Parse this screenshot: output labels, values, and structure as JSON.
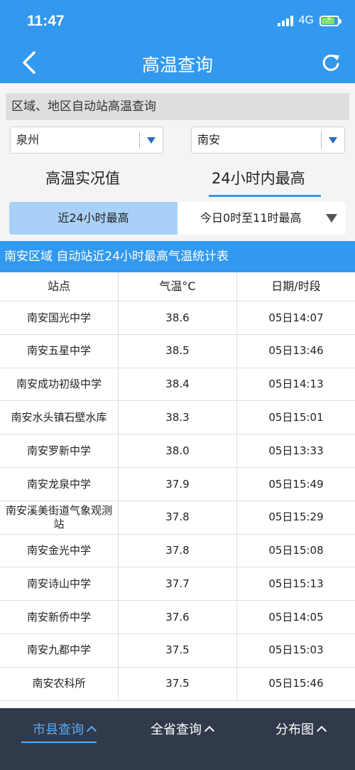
{
  "status": {
    "time": "11:47",
    "network": "4G"
  },
  "nav": {
    "title": "高温查询"
  },
  "query": {
    "section_label": "区域、地区自动站高温查询",
    "city": "泉州",
    "county": "南安"
  },
  "mode_tabs": [
    "高温实况值",
    "24小时内最高"
  ],
  "segments": [
    "近24小时最高",
    "今日0时至11时最高"
  ],
  "table": {
    "title": "南安区域 自动站近24小时最高气温统计表",
    "headers": [
      "站点",
      "气温°C",
      "日期/时段"
    ],
    "rows": [
      {
        "station": "南安国光中学",
        "temp": "38.6",
        "time": "05日14:07"
      },
      {
        "station": "南安五星中学",
        "temp": "38.5",
        "time": "05日13:46"
      },
      {
        "station": "南安成功初级中学",
        "temp": "38.4",
        "time": "05日14:13"
      },
      {
        "station": "南安水头镇石壁水库",
        "temp": "38.3",
        "time": "05日15:01"
      },
      {
        "station": "南安罗新中学",
        "temp": "38.0",
        "time": "05日13:33"
      },
      {
        "station": "南安龙泉中学",
        "temp": "37.9",
        "time": "05日15:49"
      },
      {
        "station": "南安溪美街道气象观测站",
        "temp": "37.8",
        "time": "05日15:29"
      },
      {
        "station": "南安金光中学",
        "temp": "37.8",
        "time": "05日15:08"
      },
      {
        "station": "南安诗山中学",
        "temp": "37.7",
        "time": "05日15:13"
      },
      {
        "station": "南安新侨中学",
        "temp": "37.6",
        "time": "05日14:05"
      },
      {
        "station": "南安九都中学",
        "temp": "37.5",
        "time": "05日15:03"
      },
      {
        "station": "南安农科所",
        "temp": "37.5",
        "time": "05日15:46"
      }
    ]
  },
  "bottom_tabs": [
    "市县查询",
    "全省查询",
    "分布图"
  ],
  "colors": {
    "primary": "#3399ee",
    "bottom_bar": "#313a4a",
    "active_tab": "#58aaf5",
    "segment_active": "#a9d1f7"
  }
}
